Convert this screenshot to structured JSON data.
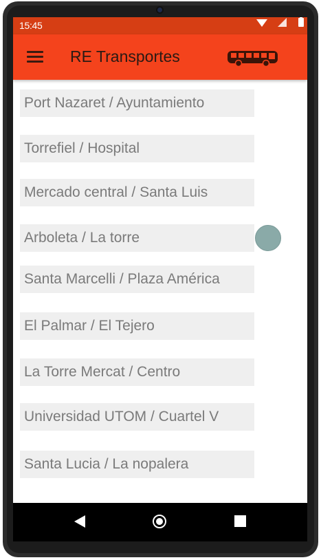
{
  "status": {
    "time": "15:45"
  },
  "appbar": {
    "title": "RE Transportes"
  },
  "routes": [
    "Port Nazaret / Ayuntamiento",
    "Torrefiel / Hospital",
    "Mercado central / Santa Luis",
    "Arboleta / La torre",
    "Santa Marcelli / Plaza América",
    "El Palmar / El Tejero",
    "La Torre Mercat / Centro",
    "Universidad UTOM / Cuartel V",
    "Santa Lucia / La nopalera"
  ],
  "colors": {
    "appbar": "#f4431c",
    "statusbar": "#d63e14",
    "list_item_bg": "#efefef",
    "list_item_text": "#7a7a7a"
  },
  "icons": {
    "menu": "hamburger-menu-icon",
    "logo": "bus-icon",
    "nav_back": "back-triangle-icon",
    "nav_home": "home-circle-icon",
    "nav_recents": "recents-square-icon"
  }
}
